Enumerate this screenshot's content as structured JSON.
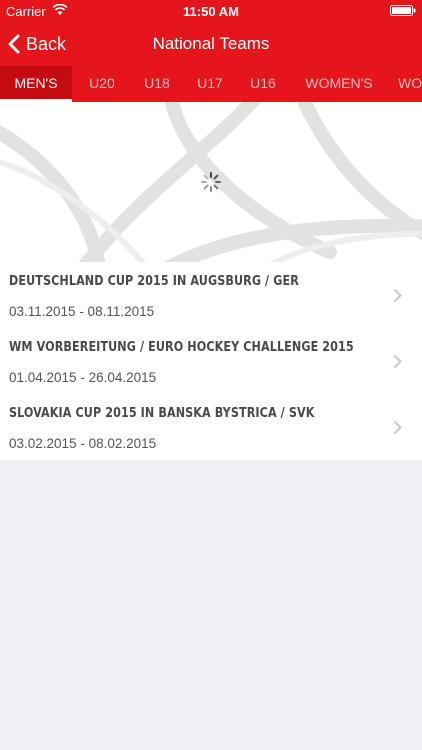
{
  "status_bar": {
    "carrier": "Carrier",
    "time": "11:50 AM"
  },
  "navbar": {
    "back_label": "Back",
    "title": "National Teams"
  },
  "tabs": [
    {
      "label": "MEN'S",
      "active": true
    },
    {
      "label": "U20",
      "active": false
    },
    {
      "label": "U18",
      "active": false
    },
    {
      "label": "U17",
      "active": false
    },
    {
      "label": "U16",
      "active": false
    },
    {
      "label": "WOMEN'S",
      "active": false
    },
    {
      "label": "WO",
      "active": false
    }
  ],
  "events": [
    {
      "title": "DEUTSCHLAND CUP 2015 IN AUGSBURG / GER",
      "dates": "03.11.2015 - 08.11.2015"
    },
    {
      "title": "WM VORBEREITUNG / EURO HOCKEY CHALLENGE 2015",
      "dates": "01.04.2015 - 26.04.2015"
    },
    {
      "title": "SLOVAKIA CUP 2015 IN BANSKA BYSTRICA / SVK",
      "dates": "03.02.2015 - 08.02.2015"
    }
  ],
  "colors": {
    "brand_red": "#e4161b",
    "active_tab": "#c40b10"
  },
  "icons": {
    "back": "chevron-left-icon",
    "row": "chevron-right-icon",
    "loading": "spinner-icon"
  }
}
